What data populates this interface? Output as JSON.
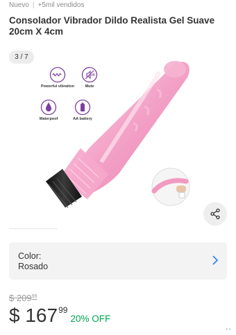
{
  "header": {
    "condition": "Nuevo",
    "separator": "|",
    "sold": "+5mil vendidos"
  },
  "product": {
    "title": "Consolador Vibrador Dildo Realista Gel Suave 20cm X 4cm"
  },
  "gallery": {
    "counter": "3 / 7",
    "features": [
      {
        "label": "Powerful vibration",
        "icon": "wave-icon"
      },
      {
        "label": "Mute",
        "icon": "mute-icon"
      },
      {
        "label": "Waterpoof",
        "icon": "water-drop-icon"
      },
      {
        "label": "AA battery",
        "icon": "battery-icon"
      }
    ]
  },
  "variant": {
    "label": "Color:",
    "value": "Rosado"
  },
  "pricing": {
    "old_currency": "$",
    "old_integer": "209",
    "old_cents": "99",
    "currency": "$",
    "integer": "167",
    "cents": "99",
    "discount": "20% OFF"
  },
  "colors": {
    "accent_blue": "#3483fa",
    "discount_green": "#00a650",
    "product_pink": "#f4a6c8",
    "feature_purple": "#7b3fa0"
  }
}
